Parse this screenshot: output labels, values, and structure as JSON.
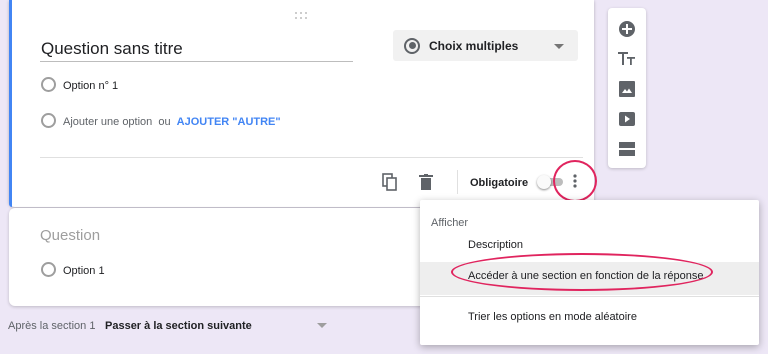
{
  "question": {
    "title": "Question sans titre",
    "type_label": "Choix multiples",
    "option_1": "Option n° 1",
    "add_option": "Ajouter une option",
    "or_text": "ou",
    "add_other": "AJOUTER \"AUTRE\""
  },
  "footer": {
    "required_label": "Obligatoire",
    "required_on": false
  },
  "side_toolbar": {
    "icons": [
      "add-question-icon",
      "title-icon",
      "image-icon",
      "video-icon",
      "section-icon"
    ]
  },
  "question2": {
    "title": "Question",
    "option_1": "Option 1"
  },
  "section": {
    "after_label": "Après la section 1",
    "next_label": "Passer à la section suivante"
  },
  "menu": {
    "header": "Afficher",
    "items": [
      "Description",
      "Accéder à une section en fonction de la réponse",
      "Trier les options en mode aléatoire"
    ]
  },
  "colors": {
    "accent": "#4285f4",
    "annotation": "#e0245e",
    "background": "#ede7f6"
  }
}
